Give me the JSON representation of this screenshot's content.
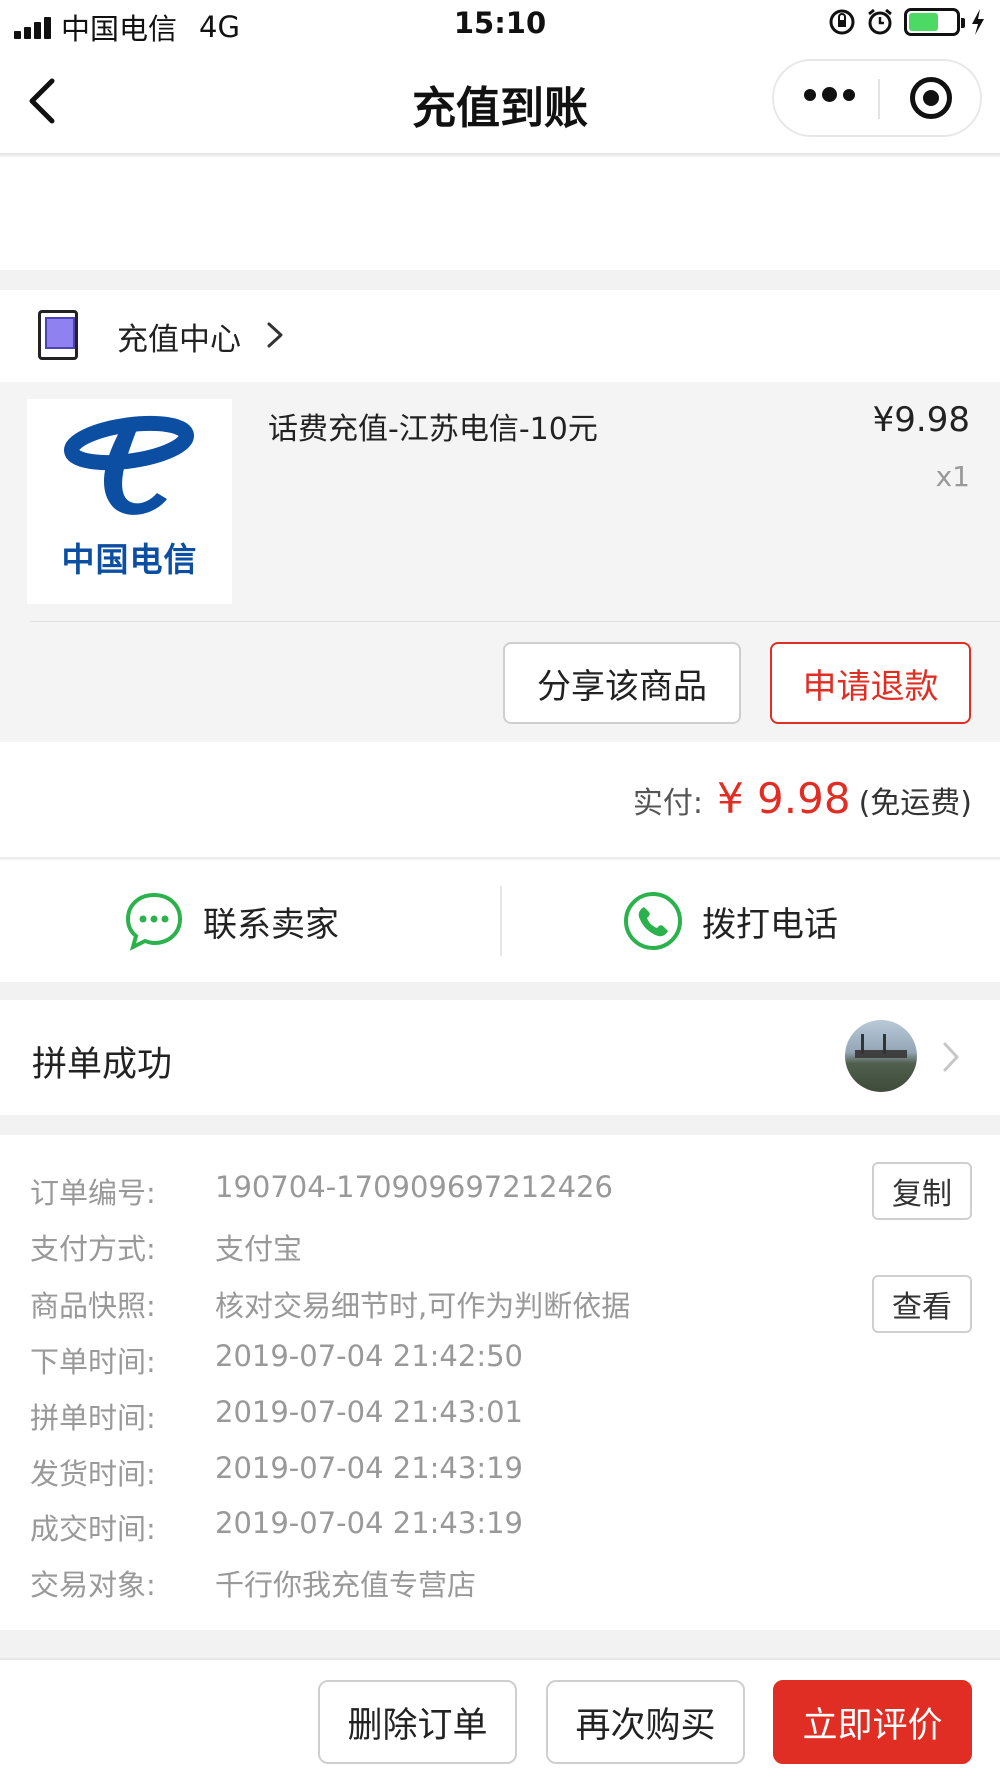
{
  "status_bar": {
    "carrier": "中国电信",
    "network": "4G",
    "time": "15:10",
    "battery_color": "#4cd964"
  },
  "nav": {
    "title": "充值到账",
    "back_icon": "back-arrow-icon",
    "more_icon": "more-dots-icon",
    "close_icon": "miniprogram-close-icon"
  },
  "store": {
    "name": "充值中心",
    "icon": "tablet-icon"
  },
  "product": {
    "logo_text": "中国电信",
    "name": "话费充值-江苏电信-10元",
    "price": "¥9.98",
    "quantity": "x1",
    "share_label": "分享该商品",
    "refund_label": "申请退款"
  },
  "payment": {
    "label": "实付:",
    "amount": "¥ 9.98",
    "note": "(免运费)"
  },
  "contact": {
    "seller_label": "联系卖家",
    "call_label": "拨打电话"
  },
  "group": {
    "title": "拼单成功"
  },
  "details": {
    "rows": [
      {
        "label": "订单编号:",
        "value": "190704-170909697212426",
        "button": "复制"
      },
      {
        "label": "支付方式:",
        "value": "支付宝"
      },
      {
        "label": "商品快照:",
        "value": "核对交易细节时,可作为判断依据",
        "button": "查看"
      },
      {
        "label": "下单时间:",
        "value": "2019-07-04 21:42:50"
      },
      {
        "label": "拼单时间:",
        "value": "2019-07-04 21:43:01"
      },
      {
        "label": "发货时间:",
        "value": "2019-07-04 21:43:19"
      },
      {
        "label": "成交时间:",
        "value": "2019-07-04 21:43:19"
      },
      {
        "label": "交易对象:",
        "value": "千行你我充值专营店"
      }
    ]
  },
  "bottom_bar": {
    "delete_label": "删除订单",
    "rebuy_label": "再次购买",
    "review_label": "立即评价"
  },
  "colors": {
    "accent_red": "#e02e24",
    "wechat_green": "#2bb24c",
    "telecom_blue": "#0b4ea2"
  }
}
